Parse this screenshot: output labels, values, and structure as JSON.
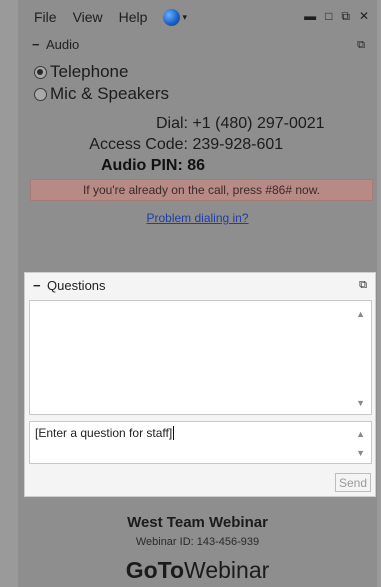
{
  "menubar": {
    "items": [
      "File",
      "View",
      "Help"
    ],
    "window_controls": [
      "minimize-icon",
      "restore-icon",
      "popout-icon",
      "close-icon"
    ]
  },
  "audio": {
    "header": "Audio",
    "options": [
      {
        "label": "Telephone",
        "selected": true
      },
      {
        "label": "Mic & Speakers",
        "selected": false
      }
    ],
    "dial_label": "Dial:",
    "dial_value": "+1 (480) 297-0021",
    "access_label": "Access Code:",
    "access_value": "239-928-601",
    "pin_label": "Audio PIN:",
    "pin_value": "86",
    "notice": "If you're already on the call, press #86# now.",
    "problem_link": "Problem dialing in?"
  },
  "questions": {
    "header": "Questions",
    "input_value": "[Enter a question for staff]",
    "send_label": "Send"
  },
  "footer": {
    "title": "West Team Webinar",
    "webinar_id_label": "Webinar ID:",
    "webinar_id": "143-456-939",
    "brand_bold": "GoTo",
    "brand_regular": "Webinar"
  },
  "colors": {
    "background": "#9a9a9a",
    "notice_bg": "#b88a86",
    "link": "#1f3ea8"
  }
}
